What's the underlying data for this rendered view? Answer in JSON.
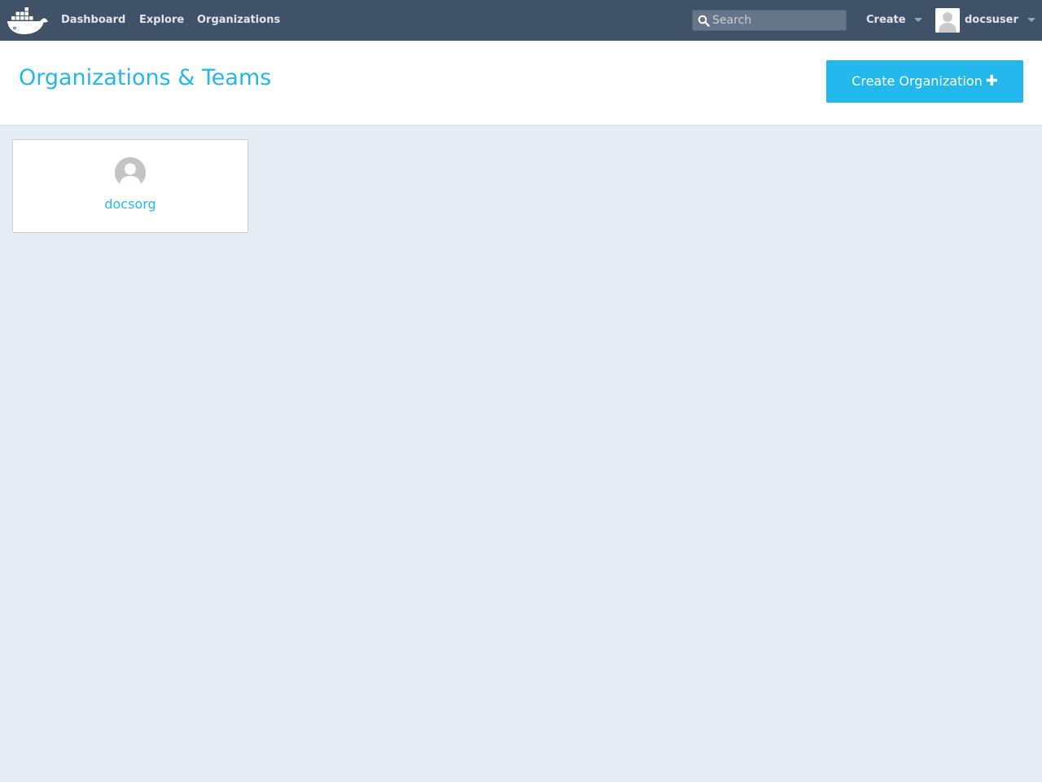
{
  "navbar": {
    "logo_icon": "docker-whale-icon",
    "links": [
      {
        "label": "Dashboard"
      },
      {
        "label": "Explore"
      },
      {
        "label": "Organizations"
      }
    ],
    "search": {
      "placeholder": "Search",
      "value": ""
    },
    "create_label": "Create",
    "user": {
      "name": "docsuser",
      "avatar_icon": "user-avatar-icon"
    },
    "background": "#3f5267"
  },
  "header": {
    "title": "Organizations & Teams",
    "create_button_label": "Create Organization",
    "create_button_icon": "plus-icon",
    "accent": "#22b8eb"
  },
  "organizations": [
    {
      "name": "docsorg",
      "avatar_icon": "org-avatar-icon"
    }
  ],
  "colors": {
    "page_background": "#e5ecf4",
    "accent": "#22b8eb"
  }
}
